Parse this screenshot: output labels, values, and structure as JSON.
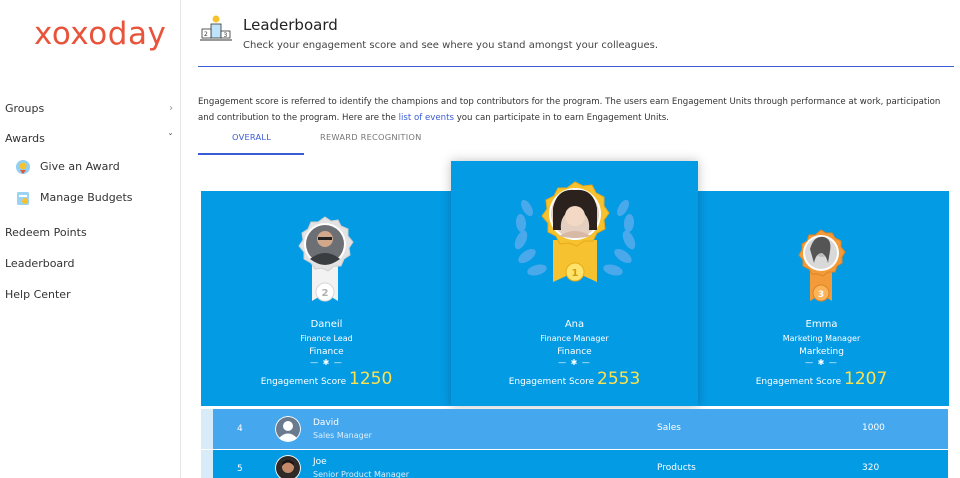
{
  "sidebar": {
    "logo": "xoxoday",
    "items": [
      {
        "label": "Groups",
        "chevron": "›"
      },
      {
        "label": "Awards",
        "chevron": "ˇ"
      },
      {
        "label": "Give an Award"
      },
      {
        "label": "Manage Budgets"
      },
      {
        "label": "Redeem Points"
      },
      {
        "label": "Leaderboard"
      },
      {
        "label": "Help Center"
      }
    ]
  },
  "header": {
    "icon": "podium-icon",
    "title": "Leaderboard",
    "subtitle": "Check your engagement score and see where you stand amongst your colleagues."
  },
  "description": {
    "text_before": "Engagement score is referred to identify the champions and top contributors for the program. The users earn Engagement Units through performance at work, participation and contribution to the program. Here are the ",
    "link": "list of events",
    "text_after": " you can participate in to earn Engagement Units."
  },
  "tabs": [
    {
      "label": "OVERALL",
      "active": true
    },
    {
      "label": "REWARD RECOGNITION",
      "active": false
    }
  ],
  "podium": [
    {
      "rank": "2",
      "name": "Daneil",
      "role": "Finance Lead",
      "department": "Finance",
      "score_label": "Engagement Score",
      "score": "1250"
    },
    {
      "rank": "1",
      "name": "Ana",
      "role": "Finance Manager",
      "department": "Finance",
      "score_label": "Engagement Score",
      "score": "2553"
    },
    {
      "rank": "3",
      "name": "Emma",
      "role": "Marketing Manager",
      "department": "Marketing",
      "score_label": "Engagement Score",
      "score": "1207"
    }
  ],
  "separator": "— ✱ —",
  "rows": [
    {
      "rank": "4",
      "name": "David",
      "role": "Sales Manager",
      "department": "Sales",
      "score": "1000"
    },
    {
      "rank": "5",
      "name": "Joe",
      "role": "Senior Product Manager",
      "department": "Products",
      "score": "320"
    }
  ],
  "colors": {
    "brand": "#e8543b",
    "accent": "#3b5bd6",
    "podium": "#049be5",
    "highlight_row": "#45a7ee",
    "score": "#ffe14d",
    "gold": "#f6c22f",
    "silver": "#e3e3e3",
    "bronze": "#f39b3a"
  }
}
